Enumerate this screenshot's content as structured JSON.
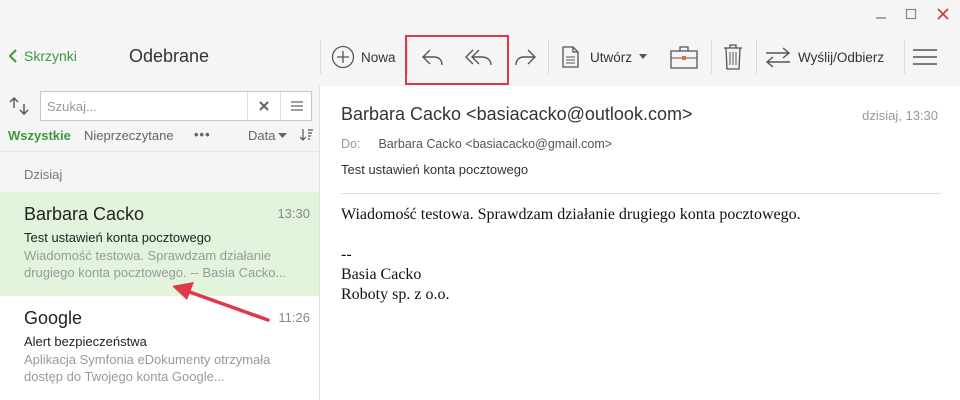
{
  "window": {
    "controls": {
      "minimize": "–",
      "maximize": "□",
      "close": "✕"
    }
  },
  "header": {
    "back_label": "Skrzynki",
    "folder_title": "Odebrane"
  },
  "toolbar": {
    "new_label": "Nowa",
    "create_label": "Utwórz",
    "send_receive_label": "Wyślij/Odbierz"
  },
  "search": {
    "placeholder": "Szukaj..."
  },
  "filters": {
    "all": "Wszystkie",
    "unread": "Nieprzeczytane",
    "more": "•••",
    "sort": "Data"
  },
  "list": {
    "group_today": "Dzisiaj",
    "messages": [
      {
        "sender": "Barbara Cacko",
        "time": "13:30",
        "subject": "Test ustawień konta pocztowego",
        "preview": "Wiadomość testowa. Sprawdzam działanie drugiego konta pocztowego. -- Basia Cacko...",
        "selected": true
      },
      {
        "sender": "Google",
        "time": "11:26",
        "subject": "Alert bezpieczeństwa",
        "preview": "Aplikacja Symfonia eDokumenty otrzymała dostęp do Twojego konta Google...",
        "selected": false
      }
    ]
  },
  "reader": {
    "from": "Barbara Cacko <basiacacko@outlook.com>",
    "date": "dzisiaj, 13:30",
    "to_label": "Do:",
    "to": "Barbara Cacko <basiacacko@gmail.com>",
    "subject": "Test ustawień konta pocztowego",
    "body_line1": "Wiadomość testowa. Sprawdzam działanie drugiego konta pocztowego.",
    "sig_sep": "--",
    "sig_name": "Basia Cacko",
    "sig_company": "Roboty sp. z o.o."
  },
  "colors": {
    "accent_green": "#3a9a3a",
    "selected_bg": "#e3f4dc",
    "annotation_red": "#e0384a"
  }
}
